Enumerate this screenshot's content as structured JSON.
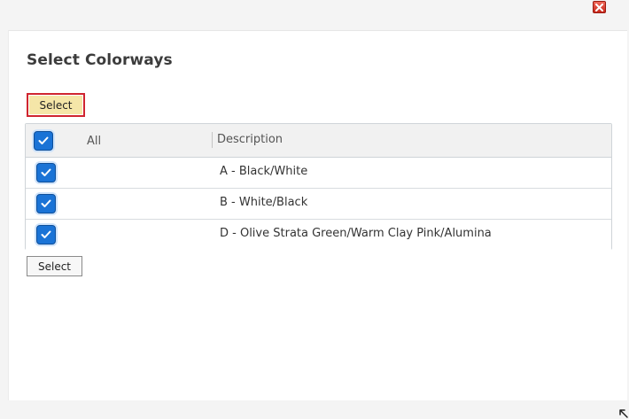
{
  "dialog": {
    "title": "Select Colorways",
    "select_top_label": "Select",
    "select_bottom_label": "Select",
    "close_icon": "close-icon",
    "resize_icon": "resize-grip-icon"
  },
  "grid": {
    "header": {
      "all_label": "All",
      "description_label": "Description",
      "all_checked": true
    },
    "rows": [
      {
        "description": "A - Black/White",
        "checked": true
      },
      {
        "description": "B - White/Black",
        "checked": true
      },
      {
        "description": "D - Olive Strata Green/Warm Clay Pink/Alumina",
        "checked": true
      }
    ]
  },
  "colors": {
    "checkbox_fill": "#1a73d6",
    "highlight_button_bg": "#f5e6a8",
    "highlight_button_border": "#d0252f",
    "close_button": "#d93a2b"
  }
}
